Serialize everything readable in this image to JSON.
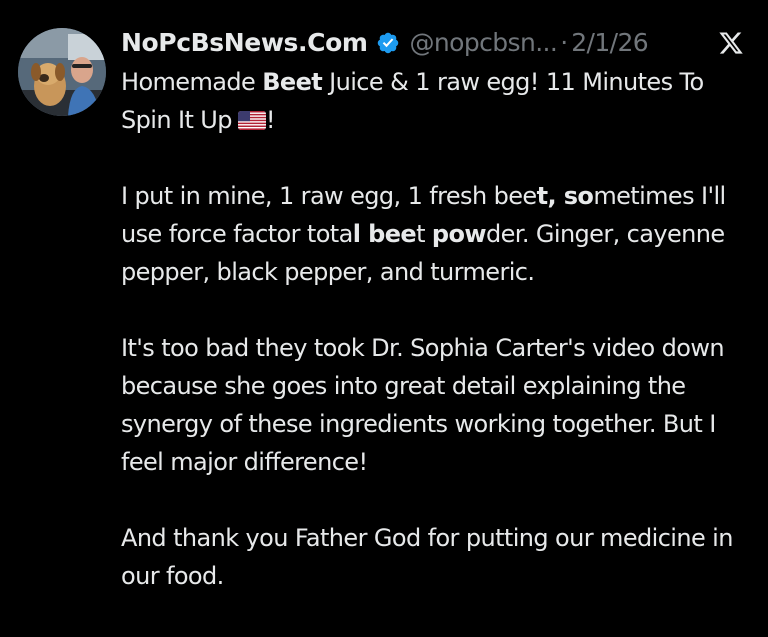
{
  "post": {
    "author": {
      "name": "NoPcBsNews.Com",
      "handle": "@nopcbsn...",
      "verified_icon": "verified-badge-icon",
      "verified_color": "#1d9bf0"
    },
    "separator": "·",
    "date": "2/1/26",
    "platform_icon": "x-logo-icon",
    "paragraph_1": {
      "prefix": "Homemade ",
      "bold": "Beet",
      "suffix": " Juice & 1 raw egg! 11 Minutes To Spin It Up",
      "flag_icon": "us-flag-icon",
      "end": "!"
    },
    "paragraph_2": {
      "segments": [
        {
          "text": "I put in mine, 1 raw egg, 1 fresh bee",
          "bold": false
        },
        {
          "text": "t, so",
          "bold": true
        },
        {
          "text": "metimes I'll use force factor tota",
          "bold": false
        },
        {
          "text": "l bee",
          "bold": true
        },
        {
          "text": "t ",
          "bold": false
        },
        {
          "text": "pow",
          "bold": true
        },
        {
          "text": "der. Ginger, cayenne pepper, black pepper, and turmeric.",
          "bold": false
        }
      ]
    },
    "paragraph_3": "It's too bad they took Dr. Sophia Carter's video down because she goes into great detail explaining the synergy of these ingredients working together. But I feel major difference!",
    "paragraph_4": "And thank you Father God for putting our medicine in our food."
  },
  "colors": {
    "background": "#000000",
    "text": "#e7e9ea",
    "secondary_text": "#71767b"
  }
}
